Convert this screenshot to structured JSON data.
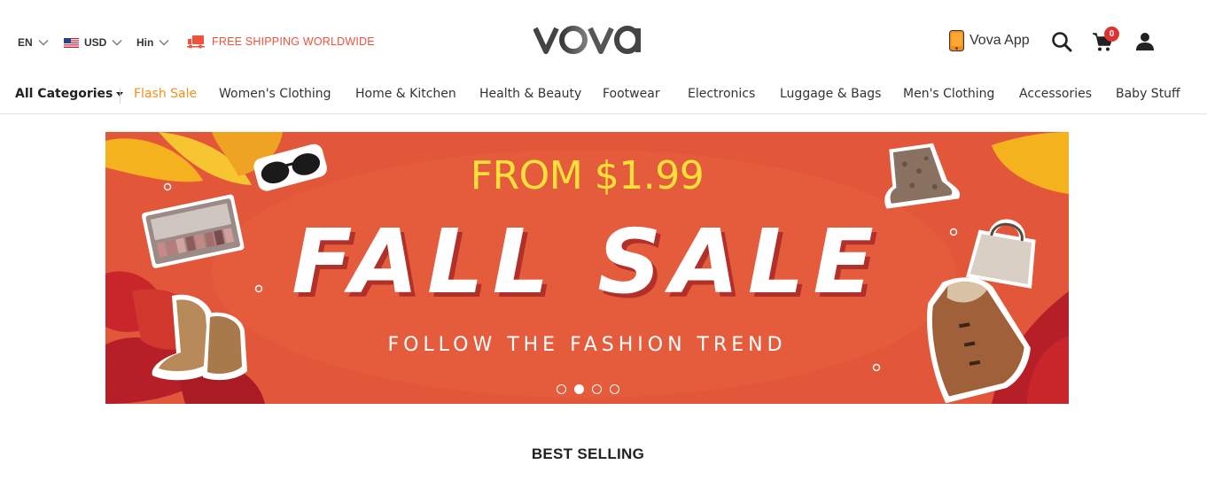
{
  "header": {
    "language": "EN",
    "currency": "USD",
    "location": "Hin",
    "shipping_text": "FREE SHIPPING WORLDWIDE",
    "logo_text": "vova",
    "app_label": "Vova App",
    "cart_count": "0"
  },
  "icons": [
    "chevron-down-icon",
    "us-flag-icon",
    "truck-icon",
    "phone-icon",
    "search-icon",
    "cart-icon",
    "user-icon",
    "caret-down-icon"
  ],
  "nav": {
    "all_categories": "All Categories",
    "items": [
      "Flash Sale",
      "Women's Clothing",
      "Home & Kitchen",
      "Health & Beauty",
      "Footwear",
      "Electronics",
      "Luggage & Bags",
      "Men's Clothing",
      "Accessories",
      "Baby Stuff"
    ]
  },
  "banner": {
    "from_text": "FROM $1.99",
    "title": "FALL SALE",
    "subtitle": "FOLLOW THE FASHION TREND",
    "slide_count": 4,
    "active_slide": 2
  },
  "sections": {
    "best_selling": "BEST SELLING"
  },
  "colors": {
    "accent_orange": "#f39019",
    "shipping_red": "#f0533a",
    "banner_bg": "#e2573a",
    "banner_yellow": "#ffe13a",
    "badge_red": "#e0332f"
  }
}
